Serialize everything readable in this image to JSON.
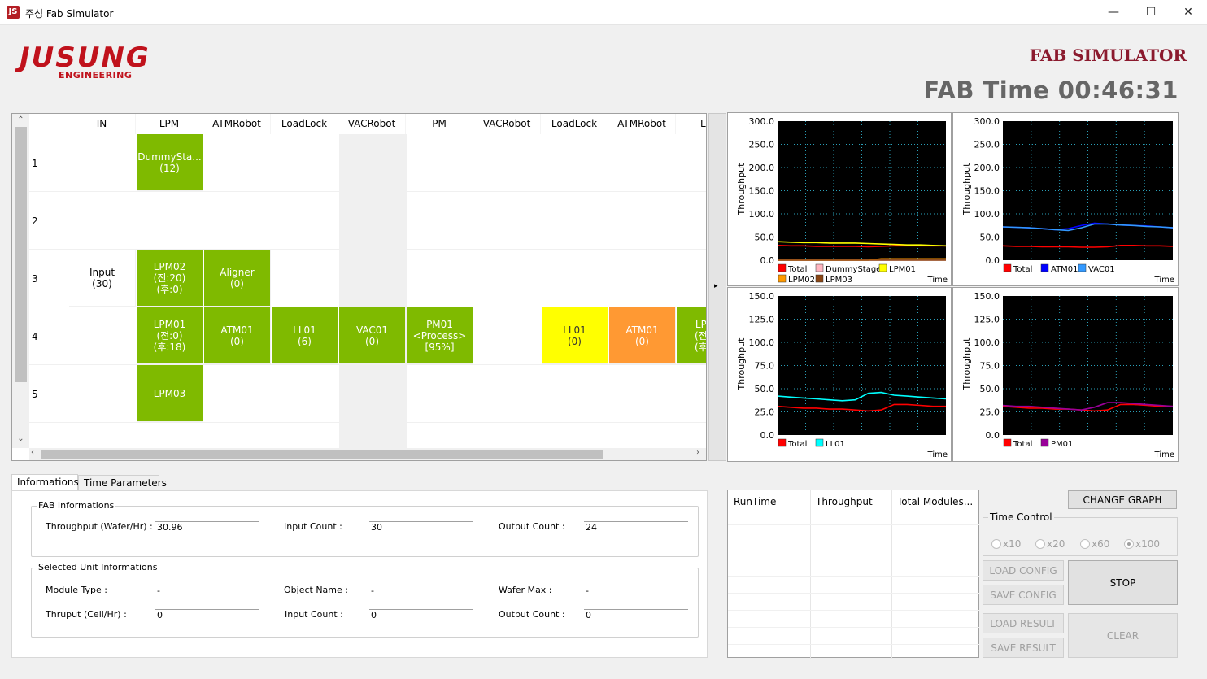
{
  "window": {
    "title": "주성 Fab Simulator",
    "icon_text": "JS",
    "minimize": "—",
    "maximize": "☐",
    "close": "✕"
  },
  "header": {
    "logo_main": "JUSUNG",
    "logo_sub": "ENGINEERING",
    "app_title": "FAB SIMULATOR",
    "fab_time": "FAB Time 00:46:31"
  },
  "grid": {
    "columns": [
      "-",
      "IN",
      "LPM",
      "ATMRobot",
      "LoadLock",
      "VACRobot",
      "PM",
      "VACRobot",
      "LoadLock",
      "ATMRobot",
      "L"
    ],
    "rows": [
      "1",
      "2",
      "3",
      "4",
      "5"
    ],
    "cells": {
      "r1_lpm": "DummySta...\n(12)",
      "r3_in": "Input\n(30)",
      "r3_lpm": "LPM02\n(전:20)\n(후:0)",
      "r3_atm": "Aligner\n(0)",
      "r4_lpm": "LPM01\n(전:0)\n(후:18)",
      "r4_atm": "ATM01\n(0)",
      "r4_ll": "LL01\n(6)",
      "r4_vac": "VAC01\n(0)",
      "r4_pm": "PM01\n<Process>\n[95%]",
      "r4_ll2": "LL01\n(0)",
      "r4_atm2": "ATM01\n(0)",
      "r4_lp_partial": "LP\n(전\n(후",
      "r5_lpm": "LPM03"
    },
    "colors": {
      "green": "#7fba00",
      "yellow": "#ffff00",
      "orange": "#ff9933"
    }
  },
  "splitter_arrow": "▸",
  "charts": [
    {
      "type": "line",
      "ylabel": "Throughput",
      "xlabel": "Time",
      "ylim": [
        0,
        300
      ],
      "yticks": [
        "300.0",
        "250.0",
        "200.0",
        "150.0",
        "100.0",
        "50.0",
        "0.0"
      ],
      "series": [
        {
          "name": "Total",
          "color": "#ff0000",
          "values": [
            32,
            31,
            31,
            30,
            30,
            30,
            30,
            29,
            30,
            31,
            31,
            31,
            31,
            31
          ]
        },
        {
          "name": "DummyStage",
          "color": "#ffb6c1",
          "values": [
            0,
            0,
            0,
            0,
            0,
            0,
            0,
            0,
            0,
            0,
            0,
            0,
            0,
            0
          ]
        },
        {
          "name": "LPM01",
          "color": "#ffff00",
          "values": [
            40,
            39,
            38,
            38,
            37,
            37,
            37,
            36,
            35,
            34,
            33,
            33,
            32,
            31
          ]
        },
        {
          "name": "LPM02",
          "color": "#ff9900",
          "values": [
            0,
            0,
            0,
            0,
            0,
            0,
            0,
            0,
            3,
            3,
            3,
            3,
            3,
            3
          ]
        },
        {
          "name": "LPM03",
          "color": "#8b4513",
          "values": [
            0,
            0,
            0,
            0,
            0,
            0,
            0,
            0,
            0,
            0,
            0,
            0,
            0,
            0
          ]
        }
      ]
    },
    {
      "type": "line",
      "ylabel": "Throughput",
      "xlabel": "Time",
      "ylim": [
        0,
        300
      ],
      "yticks": [
        "300.0",
        "250.0",
        "200.0",
        "150.0",
        "100.0",
        "50.0",
        "0.0"
      ],
      "series": [
        {
          "name": "Total",
          "color": "#ff0000",
          "values": [
            31,
            30,
            30,
            29,
            29,
            29,
            28,
            28,
            29,
            32,
            32,
            31,
            31,
            30
          ]
        },
        {
          "name": "ATM01",
          "color": "#0000ff",
          "values": [
            72,
            71,
            70,
            68,
            66,
            68,
            75,
            80,
            78,
            76,
            75,
            74,
            72,
            70
          ]
        },
        {
          "name": "VAC01",
          "color": "#3399ff",
          "values": [
            72,
            71,
            70,
            68,
            66,
            64,
            70,
            78,
            78,
            76,
            75,
            73,
            72,
            70
          ]
        }
      ]
    },
    {
      "type": "line",
      "ylabel": "Throughput",
      "xlabel": "Time",
      "ylim": [
        0,
        150
      ],
      "yticks": [
        "150.0",
        "125.0",
        "100.0",
        "75.0",
        "50.0",
        "25.0",
        "0.0"
      ],
      "series": [
        {
          "name": "Total",
          "color": "#ff0000",
          "values": [
            31,
            30,
            29,
            29,
            28,
            28,
            27,
            26,
            27,
            33,
            33,
            32,
            31,
            31
          ]
        },
        {
          "name": "LL01",
          "color": "#00ffff",
          "values": [
            42,
            41,
            40,
            39,
            38,
            37,
            38,
            45,
            46,
            43,
            42,
            41,
            40,
            39
          ]
        }
      ]
    },
    {
      "type": "line",
      "ylabel": "Throughput",
      "xlabel": "Time",
      "ylim": [
        0,
        150
      ],
      "yticks": [
        "150.0",
        "125.0",
        "100.0",
        "75.0",
        "50.0",
        "25.0",
        "0.0"
      ],
      "series": [
        {
          "name": "Total",
          "color": "#ff0000",
          "values": [
            31,
            30,
            29,
            29,
            28,
            28,
            27,
            26,
            27,
            33,
            33,
            32,
            31,
            31
          ]
        },
        {
          "name": "PM01",
          "color": "#990099",
          "values": [
            32,
            31,
            31,
            30,
            29,
            28,
            27,
            30,
            35,
            35,
            34,
            33,
            32,
            31
          ]
        }
      ]
    }
  ],
  "tabs": [
    "Informations",
    "Time Parameters"
  ],
  "fab_info": {
    "title": "FAB Informations",
    "throughput_label": "Throughput (Wafer/Hr) :",
    "throughput": "30.96",
    "input_label": "Input Count :",
    "input": "30",
    "output_label": "Output Count :",
    "output": "24"
  },
  "unit_info": {
    "title": "Selected Unit Informations",
    "module_type_label": "Module Type :",
    "module_type": "-",
    "object_name_label": "Object Name :",
    "object_name": "-",
    "wafer_max_label": "Wafer Max :",
    "wafer_max": "-",
    "thruput_label": "Thruput (Cell/Hr) :",
    "thruput": "0",
    "input_label": "Input Count :",
    "input": "0",
    "output_label": "Output Count :",
    "output": "0"
  },
  "results": {
    "headers": [
      "RunTime",
      "Throughput",
      "Total Modules..."
    ]
  },
  "controls": {
    "change_graph": "CHANGE GRAPH",
    "time_control": "Time Control",
    "speeds": [
      "x10",
      "x20",
      "x60",
      "x100"
    ],
    "selected_speed": "x100",
    "load_config": "LOAD CONFIG",
    "save_config": "SAVE CONFIG",
    "stop": "STOP",
    "load_result": "LOAD RESULT",
    "save_result": "SAVE RESULT",
    "clear": "CLEAR"
  }
}
